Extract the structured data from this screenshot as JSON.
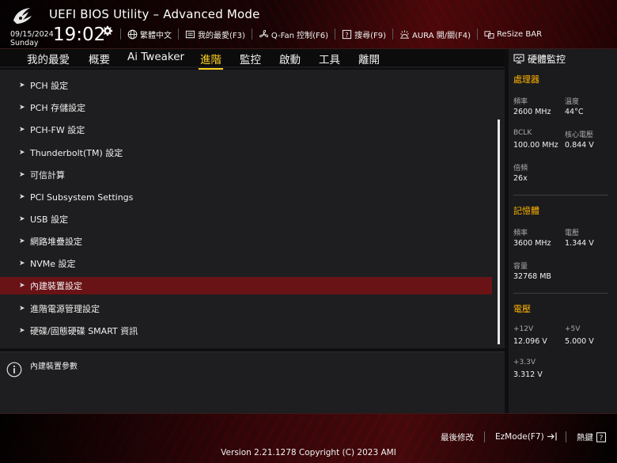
{
  "header": {
    "title": "UEFI BIOS Utility – Advanced Mode",
    "date": "09/15/2024",
    "day": "Sunday",
    "time": "19:02",
    "toolbar": [
      {
        "label": "繁體中文",
        "icon": "globe-icon"
      },
      {
        "label": "我的最愛(F3)",
        "icon": "favorites-icon"
      },
      {
        "label": "Q-Fan 控制(F6)",
        "icon": "fan-icon"
      },
      {
        "label": "搜尋(F9)",
        "icon": "search-help-icon"
      },
      {
        "label": "AURA 開/關(F4)",
        "icon": "aura-icon"
      },
      {
        "label": "ReSize BAR",
        "icon": "resize-bar-icon"
      }
    ]
  },
  "tabs": [
    "我的最愛",
    "概要",
    "Ai Tweaker",
    "進階",
    "監控",
    "啟動",
    "工具",
    "離開"
  ],
  "active_tab": "進階",
  "menu": [
    "PCH 設定",
    "PCH 存儲設定",
    "PCH-FW 設定",
    "Thunderbolt(TM) 設定",
    "可信計算",
    "PCI Subsystem Settings",
    "USB 設定",
    "網路堆疊設定",
    "NVMe 設定",
    "內建裝置設定",
    "進階電源管理設定",
    "硬碟/固態硬碟 SMART 資訊"
  ],
  "selected_menu": "內建裝置設定",
  "help_text": "內建裝置參數",
  "monitor": {
    "title": "硬體監控",
    "cpu": {
      "title": "處理器",
      "freq_label": "頻率",
      "freq": "2600 MHz",
      "temp_label": "溫度",
      "temp": "44°C",
      "bclk_label": "BCLK",
      "bclk": "100.00 MHz",
      "vcore_label": "核心電壓",
      "vcore": "0.844 V",
      "ratio_label": "倍頻",
      "ratio": "26x"
    },
    "memory": {
      "title": "記憶體",
      "freq_label": "頻率",
      "freq": "3600 MHz",
      "volt_label": "電壓",
      "volt": "1.344 V",
      "cap_label": "容量",
      "cap": "32768 MB"
    },
    "voltage": {
      "title": "電壓",
      "v12_label": "+12V",
      "v12": "12.096 V",
      "v5_label": "+5V",
      "v5": "5.000 V",
      "v33_label": "+3.3V",
      "v33": "3.312 V"
    }
  },
  "footer": {
    "last_modified": "最後修改",
    "ezmode": "EzMode(F7)",
    "hotkeys": "熱鍵",
    "version": "Version 2.21.1278 Copyright (C) 2023 AMI"
  },
  "colors": {
    "accent": "#ffd21f",
    "selected_row": "#6a1317",
    "section_title": "#ffb400"
  }
}
